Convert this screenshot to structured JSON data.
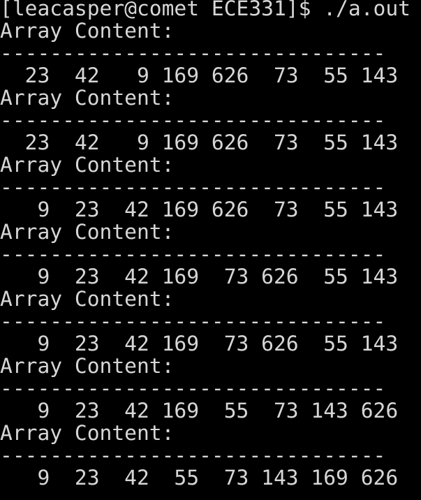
{
  "terminal": {
    "prompt": "[leacasper@comet ECE331]$ ./a.out",
    "blocks": [
      {
        "heading": "Array Content:",
        "separator": "-------------------------------",
        "values": "  23  42   9 169 626  73  55 143"
      },
      {
        "heading": "Array Content:",
        "separator": "-------------------------------",
        "values": "  23  42   9 169 626  73  55 143"
      },
      {
        "heading": "Array Content:",
        "separator": "-------------------------------",
        "values": "   9  23  42 169 626  73  55 143"
      },
      {
        "heading": "Array Content:",
        "separator": "-------------------------------",
        "values": "   9  23  42 169  73 626  55 143"
      },
      {
        "heading": "Array Content:",
        "separator": "-------------------------------",
        "values": "   9  23  42 169  73 626  55 143"
      },
      {
        "heading": "Array Content:",
        "separator": "-------------------------------",
        "values": "   9  23  42 169  55  73 143 626"
      },
      {
        "heading": "Array Content:",
        "separator": "-------------------------------",
        "values": "   9  23  42  55  73 143 169 626"
      }
    ]
  }
}
